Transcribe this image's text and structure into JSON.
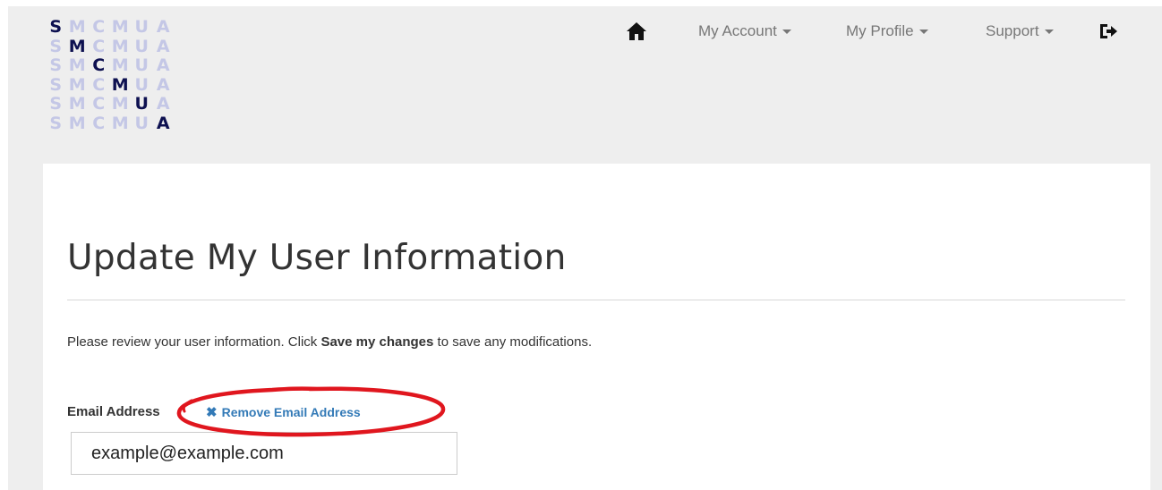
{
  "logo": {
    "rows": [
      [
        "S",
        "M",
        "C",
        "M",
        "U",
        "A"
      ],
      [
        "S",
        "M",
        "C",
        "M",
        "U",
        "A"
      ],
      [
        "S",
        "M",
        "C",
        "M",
        "U",
        "A"
      ],
      [
        "S",
        "M",
        "C",
        "M",
        "U",
        "A"
      ],
      [
        "S",
        "M",
        "C",
        "M",
        "U",
        "A"
      ],
      [
        "S",
        "M",
        "C",
        "M",
        "U",
        "A"
      ]
    ],
    "highlight_color": "#0d1050",
    "faded_color": "#c4c7e6"
  },
  "nav": {
    "home_icon": "home-icon",
    "my_account": "My Account",
    "my_profile": "My Profile",
    "support": "Support",
    "logout_icon": "logout-icon"
  },
  "main": {
    "title": "Update My User Information",
    "intro_before": "Please review your user information. Click ",
    "intro_bold": "Save my changes",
    "intro_after": " to save any modifications.",
    "email_label": "Email Address",
    "remove_icon": "✖",
    "remove_label": "Remove Email Address",
    "email_value": "example@example.com"
  },
  "colors": {
    "link": "#337ab7",
    "annotation": "#e0161e",
    "nav_text": "#777777"
  }
}
